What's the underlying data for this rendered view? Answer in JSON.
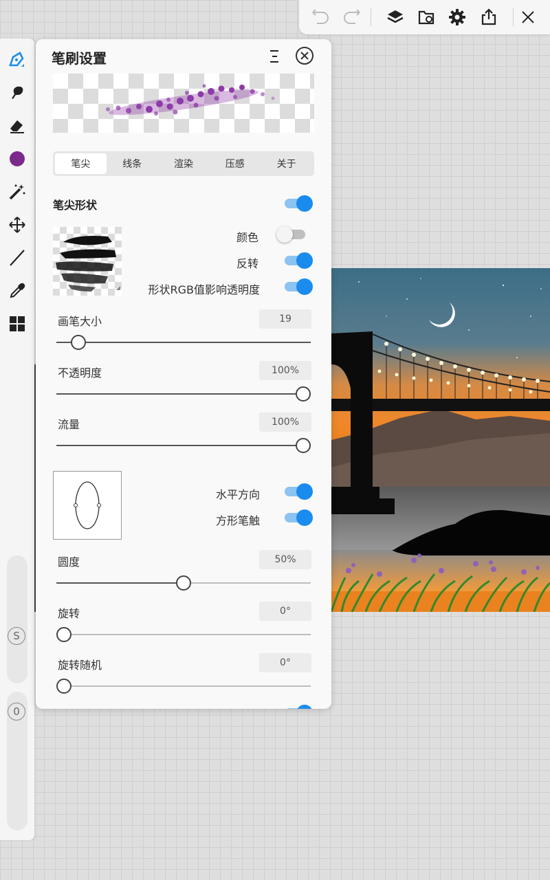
{
  "toolbar": {
    "icons": [
      "undo-icon",
      "redo-icon",
      "layers-icon",
      "gallery-icon",
      "settings-icon",
      "share-icon",
      "close-icon"
    ]
  },
  "left_tools": {
    "icons": [
      "brush-icon",
      "smudge-icon",
      "eraser-icon",
      "color-icon",
      "magic-wand-icon",
      "move-icon",
      "line-icon",
      "eyedropper-icon",
      "grid-icon"
    ],
    "current_color": "#7b2a8c",
    "size_label": "S",
    "opacity_label": "0"
  },
  "panel": {
    "title": "笔刷设置",
    "tabs": [
      {
        "label": "笔尖",
        "active": true
      },
      {
        "label": "线条",
        "active": false
      },
      {
        "label": "渲染",
        "active": false
      },
      {
        "label": "压感",
        "active": false
      },
      {
        "label": "关于",
        "active": false
      }
    ],
    "section_title": "笔尖形状",
    "section_toggle_on": true,
    "tip_toggles": [
      {
        "label": "颜色",
        "on": false
      },
      {
        "label": "反转",
        "on": true
      },
      {
        "label": "形状RGB值影响透明度",
        "on": true
      }
    ],
    "params": {
      "size": {
        "label": "画笔大小",
        "value": "19",
        "fraction": 0.06
      },
      "opacity": {
        "label": "不透明度",
        "value": "100%",
        "fraction": 1.0
      },
      "flow": {
        "label": "流量",
        "value": "100%",
        "fraction": 1.0
      },
      "roundness": {
        "label": "圆度",
        "value": "50%",
        "fraction": 0.5
      },
      "rotation": {
        "label": "旋转",
        "value": "0°",
        "fraction": 0.0
      },
      "rotation_random": {
        "label": "旋转随机",
        "value": "0°",
        "fraction": 0.0
      }
    },
    "angle_toggles": [
      {
        "label": "水平方向",
        "on": true
      },
      {
        "label": "方形笔触",
        "on": true
      }
    ]
  },
  "colors": {
    "accent": "#1a8cf0",
    "brush_purple": "#8e3aa8"
  }
}
